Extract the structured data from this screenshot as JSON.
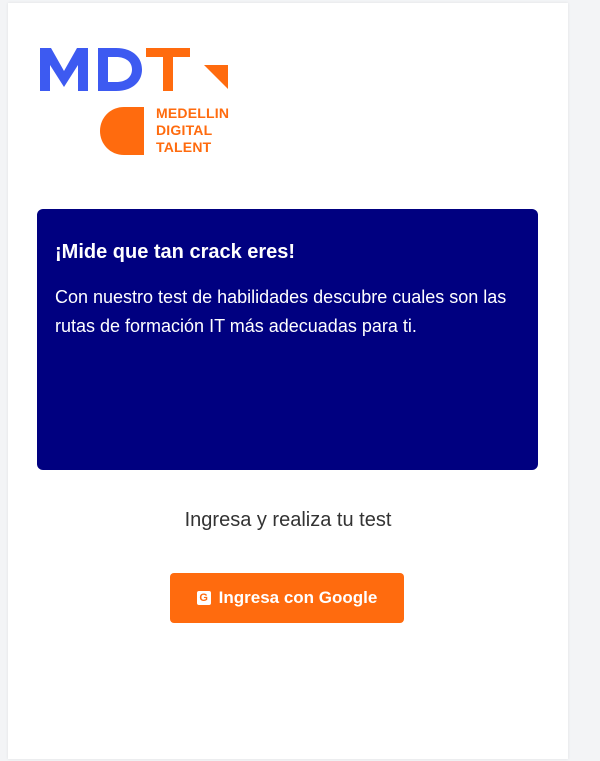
{
  "logo": {
    "letters": "MDT",
    "lines": [
      "MEDELLIN",
      "DIGITAL",
      "TALENT"
    ],
    "colors": {
      "blue": "#3d5af1",
      "orange": "#ff6b0e"
    }
  },
  "hero": {
    "title": "¡Mide que tan crack eres!",
    "text": "Con nuestro test de habilidades descubre cuales son las rutas de formación IT más adecuadas para ti.",
    "background": "#000080"
  },
  "cta": {
    "label": "Ingresa y realiza tu test",
    "button_label": "Ingresa con Google",
    "button_icon": "google-icon"
  }
}
